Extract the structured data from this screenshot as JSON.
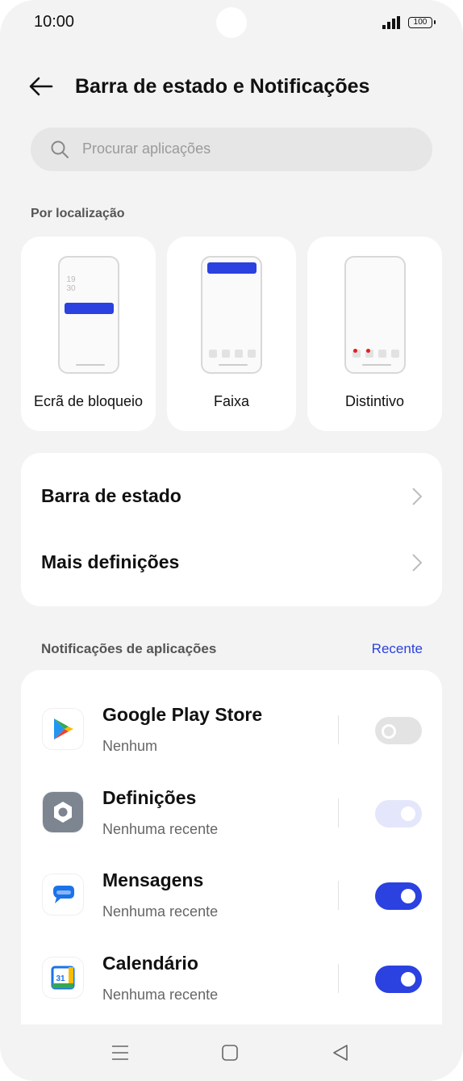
{
  "status_bar": {
    "time": "10:00",
    "battery": "100"
  },
  "header": {
    "title": "Barra de estado e Notificações"
  },
  "search": {
    "placeholder": "Procurar aplicações"
  },
  "location_section": {
    "label": "Por localização",
    "cards": [
      {
        "label": "Ecrã de bloqueio",
        "clock": "19\n30"
      },
      {
        "label": "Faixa"
      },
      {
        "label": "Distintivo"
      }
    ]
  },
  "settings": {
    "items": [
      {
        "label": "Barra de estado"
      },
      {
        "label": "Mais definições"
      }
    ]
  },
  "app_notifications": {
    "label": "Notificações de aplicações",
    "sort_link": "Recente",
    "apps": [
      {
        "name": "Google Play Store",
        "status": "Nenhum",
        "toggle": "off"
      },
      {
        "name": "Definições",
        "status": "Nenhuma recente",
        "toggle": "on-disabled"
      },
      {
        "name": "Mensagens",
        "status": "Nenhuma recente",
        "toggle": "on"
      },
      {
        "name": "Calendário",
        "status": "Nenhuma recente",
        "toggle": "on"
      }
    ]
  },
  "colors": {
    "accent": "#2b41e0",
    "background": "#f3f3f3",
    "card": "#ffffff"
  },
  "icons": [
    "back-arrow-icon",
    "search-icon",
    "chevron-right-icon",
    "play-store-icon",
    "settings-gear-icon",
    "messages-icon",
    "calendar-icon",
    "menu-icon",
    "home-icon",
    "back-triangle-icon"
  ]
}
